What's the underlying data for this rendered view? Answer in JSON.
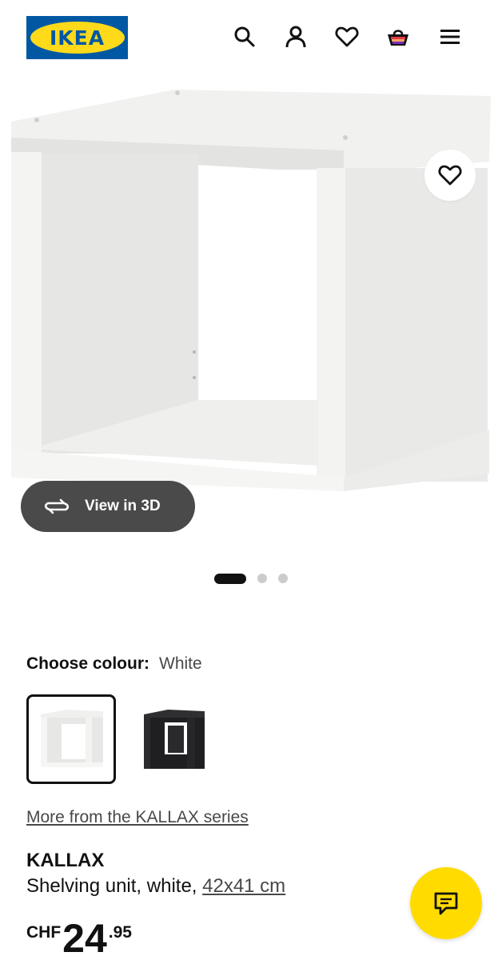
{
  "brand": {
    "logo_text": "IKEA",
    "blue": "#0058a3",
    "yellow": "#ffda1a"
  },
  "header": {
    "icons": [
      "search-icon",
      "account-icon",
      "heart-icon",
      "basket-icon",
      "menu-icon"
    ]
  },
  "gallery": {
    "view_3d_label": "View in 3D",
    "slides": 3,
    "active_slide": 1
  },
  "colour": {
    "label": "Choose colour:",
    "selected": "White",
    "options": [
      "White",
      "Black-brown"
    ]
  },
  "series_link": "More from the KALLAX series",
  "product": {
    "name": "KALLAX",
    "description": "Shelving unit, white, ",
    "size": "42x41 cm"
  },
  "price": {
    "currency": "CHF",
    "integer": "24",
    "decimal": ".95"
  },
  "colors": {
    "chat_button": "#ffdb00",
    "view3d_bg": "#4a4a4a",
    "text_dark": "#111111"
  }
}
